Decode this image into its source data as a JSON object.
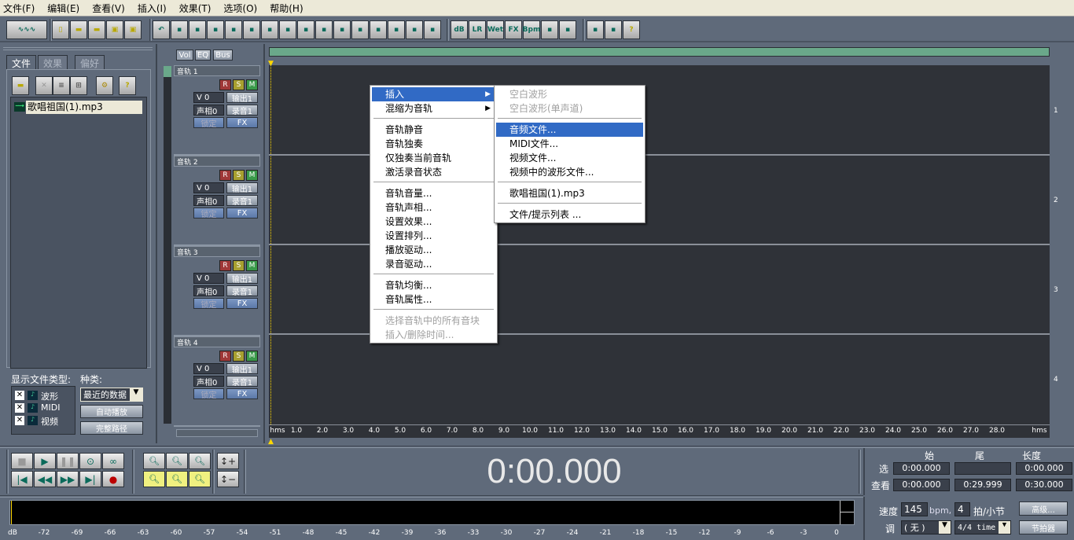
{
  "menu": [
    "文件(F)",
    "编辑(E)",
    "查看(V)",
    "插入(I)",
    "效果(T)",
    "选项(O)",
    "帮助(H)"
  ],
  "toolbar_icons": [
    "waveform-view-icon",
    "new-icon",
    "open-icon",
    "open-append-icon",
    "save-icon",
    "save-all-icon",
    "undo-icon",
    "cut-icon",
    "trim-icon",
    "split-icon",
    "merge-icon",
    "crossfade-icon",
    "mix-icon",
    "lock-icon",
    "group-icon",
    "loop-icon",
    "align-icon",
    "new-waveform-icon",
    "record-icon",
    "new-q-icon",
    "ruler-icon",
    "bounce-icon",
    "db-icon",
    "pan-icon",
    "wet-icon",
    "fx-icon",
    "bpm-icon",
    "envelope-icon",
    "snap-icon",
    "options-icon",
    "time-lock-icon",
    "help-icon"
  ],
  "toolbar_labels": {
    "wet": "Wet",
    "fx": "FX",
    "bpm": "Bpm",
    "db": "dB"
  },
  "left_panel": {
    "tabs": [
      "文件",
      "效果",
      "偏好"
    ],
    "active_tab": "文件",
    "files": [
      "歌唱祖国(1).mp3"
    ],
    "show_types_label": "显示文件类型:",
    "types": [
      {
        "label": "波形",
        "checked": true
      },
      {
        "label": "MIDI",
        "checked": true
      },
      {
        "label": "视频",
        "checked": true
      }
    ],
    "kind_label": "种类:",
    "kind_value": "最近的数据",
    "autoplay": "自动播放",
    "fullpath": "完整路径"
  },
  "mixer_tabs": [
    "Vol",
    "EQ",
    "Bus"
  ],
  "tracks": [
    {
      "name": "音轨 1",
      "vol": "V 0",
      "pan": "声相0",
      "out": "输出1",
      "rec": "录音1",
      "lock": "锁定",
      "fx": "FX",
      "num": "1"
    },
    {
      "name": "音轨 2",
      "vol": "V 0",
      "pan": "声相0",
      "out": "输出1",
      "rec": "录音1",
      "lock": "锁定",
      "fx": "FX",
      "num": "2"
    },
    {
      "name": "音轨 3",
      "vol": "V 0",
      "pan": "声相0",
      "out": "输出1",
      "rec": "录音1",
      "lock": "锁定",
      "fx": "FX",
      "num": "3"
    },
    {
      "name": "音轨 4",
      "vol": "V 0",
      "pan": "声相0",
      "out": "输出1",
      "rec": "录音1",
      "lock": "锁定",
      "fx": "FX",
      "num": "4"
    }
  ],
  "rsm": [
    "R",
    "S",
    "M"
  ],
  "context_menu": {
    "items": [
      {
        "label": "插入",
        "submenu": true,
        "highlight": true
      },
      {
        "label": "混缩为音轨",
        "submenu": true
      },
      {
        "sep": true
      },
      {
        "label": "音轨静音"
      },
      {
        "label": "音轨独奏"
      },
      {
        "label": "仅独奏当前音轨"
      },
      {
        "label": "激活录音状态"
      },
      {
        "sep": true
      },
      {
        "label": "音轨音量..."
      },
      {
        "label": "音轨声相..."
      },
      {
        "label": "设置效果..."
      },
      {
        "label": "设置排列..."
      },
      {
        "label": "播放驱动..."
      },
      {
        "label": "录音驱动..."
      },
      {
        "sep": true
      },
      {
        "label": "音轨均衡..."
      },
      {
        "label": "音轨属性..."
      },
      {
        "sep": true
      },
      {
        "label": "选择音轨中的所有音块",
        "disabled": true
      },
      {
        "label": "插入/删除时间...",
        "disabled": true
      }
    ],
    "submenu": [
      {
        "label": "空白波形",
        "disabled": true
      },
      {
        "label": "空白波形(单声道)",
        "disabled": true
      },
      {
        "sep": true
      },
      {
        "label": "音频文件...",
        "highlight": true
      },
      {
        "label": "MIDI文件..."
      },
      {
        "label": "视频文件..."
      },
      {
        "label": "视频中的波形文件..."
      },
      {
        "sep": true
      },
      {
        "label": "歌唱祖国(1).mp3"
      },
      {
        "sep": true
      },
      {
        "label": "文件/提示列表 ..."
      }
    ]
  },
  "ruler": {
    "unit": "hms",
    "ticks": [
      "1.0",
      "2.0",
      "3.0",
      "4.0",
      "5.0",
      "6.0",
      "7.0",
      "8.0",
      "9.0",
      "10.0",
      "11.0",
      "12.0",
      "13.0",
      "14.0",
      "15.0",
      "16.0",
      "17.0",
      "18.0",
      "19.0",
      "20.0",
      "21.0",
      "22.0",
      "23.0",
      "24.0",
      "25.0",
      "26.0",
      "27.0",
      "28.0"
    ]
  },
  "time_display": "0:00.000",
  "selection": {
    "headers": [
      "始",
      "尾",
      "长度"
    ],
    "rows": [
      {
        "label": "选",
        "begin": "0:00.000",
        "end": "",
        "length": "0:00.000"
      },
      {
        "label": "查看",
        "begin": "0:00.000",
        "end": "0:29.999",
        "length": "0:30.000"
      }
    ]
  },
  "tempo": {
    "label": "速度",
    "bpm": "145",
    "bpm_unit": "bpm,",
    "beats": "4",
    "beats_label": "拍/小节",
    "key_label": "调",
    "key": "( 无 )",
    "time_sig": "4/4 time",
    "advanced": "高级...",
    "metronome": "节拍器"
  },
  "level_meter": {
    "unit": "dB",
    "ticks": [
      "-72",
      "-69",
      "-66",
      "-63",
      "-60",
      "-57",
      "-54",
      "-51",
      "-48",
      "-45",
      "-42",
      "-39",
      "-36",
      "-33",
      "-30",
      "-27",
      "-24",
      "-21",
      "-18",
      "-15",
      "-12",
      "-9",
      "-6",
      "-3",
      "0"
    ]
  },
  "colors": {
    "accent": "#316ac5",
    "track_bg": "#2f3238",
    "panel": "#5f6a7a",
    "green": "#6aa88a"
  }
}
